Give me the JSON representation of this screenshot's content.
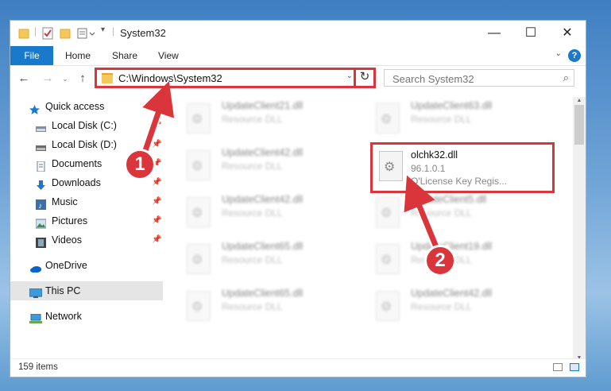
{
  "window": {
    "title": "System32",
    "controls": {
      "minimize": "—",
      "maximize": "☐",
      "close": "✕"
    }
  },
  "ribbon": {
    "tabs": [
      "File",
      "Home",
      "Share",
      "View"
    ],
    "help": "?"
  },
  "nav": {
    "address_path": "C:\\Windows\\System32",
    "search_placeholder": "Search System32"
  },
  "sidebar": {
    "items": [
      {
        "label": "Quick access",
        "icon": "star-icon",
        "pinned": false
      },
      {
        "label": "Local Disk (C:)",
        "icon": "drive-icon",
        "pinned": true
      },
      {
        "label": "Local Disk (D:)",
        "icon": "drive-icon",
        "pinned": true
      },
      {
        "label": "Documents",
        "icon": "documents-icon",
        "pinned": true
      },
      {
        "label": "Downloads",
        "icon": "download-icon",
        "pinned": true
      },
      {
        "label": "Music",
        "icon": "music-icon",
        "pinned": true
      },
      {
        "label": "Pictures",
        "icon": "pictures-icon",
        "pinned": true
      },
      {
        "label": "Videos",
        "icon": "videos-icon",
        "pinned": true
      },
      {
        "label": "OneDrive",
        "icon": "cloud-icon",
        "pinned": false
      },
      {
        "label": "This PC",
        "icon": "computer-icon",
        "pinned": false
      },
      {
        "label": "Network",
        "icon": "network-icon",
        "pinned": false
      }
    ]
  },
  "files": {
    "left": [
      {
        "name": "UpdateClient21.dll",
        "desc": "Resource DLL"
      },
      {
        "name": "UpdateClient42.dll",
        "desc": "Resource DLL"
      },
      {
        "name": "UpdateClient42.dll",
        "desc": "Resource DLL"
      },
      {
        "name": "UpdateClient65.dll",
        "desc": "Resource DLL"
      },
      {
        "name": "UpdateClient65.dll",
        "desc": "Resource DLL"
      }
    ],
    "right": [
      {
        "name": "UpdateClient63.dll",
        "desc": "Resource DLL"
      },
      {
        "name": "olchk32.dll",
        "desc": "96.1.0.1",
        "extra": "O'License Key Regis..."
      },
      {
        "name": "UpdateClient5.dll",
        "desc": "Resource DLL"
      },
      {
        "name": "UpdateClient19.dll",
        "desc": "Resource DLL"
      },
      {
        "name": "UpdateClient42.dll",
        "desc": "Resource DLL"
      }
    ]
  },
  "status": {
    "count": "159 items"
  },
  "callouts": {
    "one": "1",
    "two": "2"
  },
  "colors": {
    "accent": "#1979ca",
    "highlight": "#d9353a"
  }
}
